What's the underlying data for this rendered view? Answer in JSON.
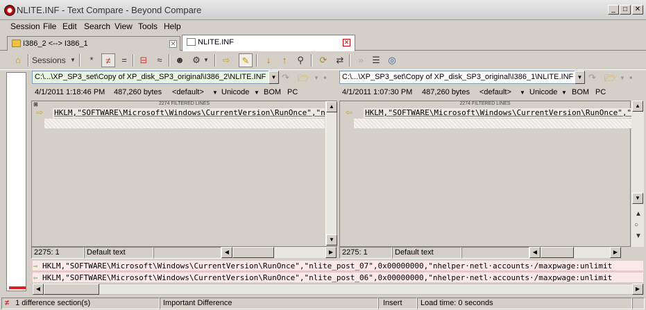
{
  "window": {
    "title": "NLITE.INF - Text Compare - Beyond Compare"
  },
  "menu": [
    "Session",
    "File",
    "Edit",
    "Search",
    "View",
    "Tools",
    "Help"
  ],
  "tabs": [
    {
      "label": "I386_2 <--> I386_1",
      "active": false
    },
    {
      "label": "NLITE.INF",
      "active": true
    }
  ],
  "toolbar": {
    "sessions_label": "Sessions"
  },
  "left": {
    "path": "C:\\...\\XP_SP3_set\\Copy of XP_disk_SP3_original\\I386_2\\NLITE.INF",
    "date": "4/1/2011 1:18:46 PM",
    "size": "487,260 bytes",
    "format": "<default>",
    "encoding": "Unicode",
    "bom": "BOM",
    "line_end": "PC",
    "filtered": "2274 FILTERED LINES",
    "line": "HKLM,\"SOFTWARE\\Microsoft\\Windows\\CurrentVersion\\RunOnce\",\"nlite_post_07\"",
    "position": "2275: 1",
    "text_type": "Default text"
  },
  "right": {
    "path": "C:\\...\\XP_SP3_set\\Copy of XP_disk_SP3_original\\I386_1\\NLITE.INF",
    "date": "4/1/2011 1:07:30 PM",
    "size": "487,260 bytes",
    "format": "<default>",
    "encoding": "Unicode",
    "bom": "BOM",
    "line_end": "PC",
    "filtered": "2274 FILTERED LINES",
    "line": "HKLM,\"SOFTWARE\\Microsoft\\Windows\\CurrentVersion\\RunOnce\",\"nlite_post_06\"",
    "position": "2275: 1",
    "text_type": "Default text"
  },
  "compare": {
    "line_top": "HKLM,\"SOFTWARE\\Microsoft\\Windows\\CurrentVersion\\RunOnce\",\"nlite_post_07\",0x00000000,\"nhelper·netl·accounts·/maxpwage:unlimit",
    "line_bottom": "HKLM,\"SOFTWARE\\Microsoft\\Windows\\CurrentVersion\\RunOnce\",\"nlite_post_06\",0x00000000,\"nhelper·netl·accounts·/maxpwage:unlimit"
  },
  "status": {
    "diff_count": "1 difference section(s)",
    "importance": "Important Difference",
    "mode": "Insert",
    "load_time": "Load time: 0 seconds"
  },
  "colors": {
    "diff_red": "#e02020",
    "diff_bg": "#fbe9e9",
    "accent_path_bg": "#e8f5e0"
  }
}
